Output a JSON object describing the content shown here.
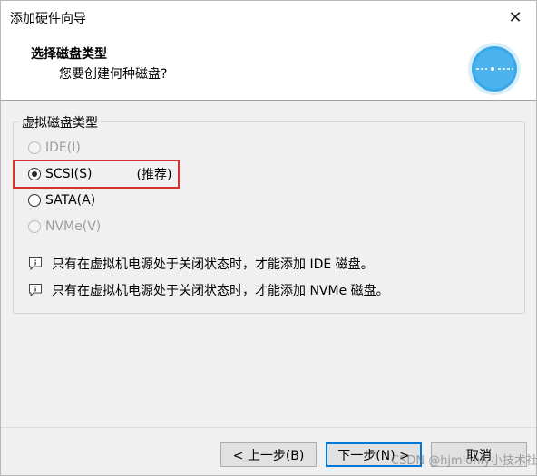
{
  "window": {
    "title": "添加硬件向导",
    "close_glyph": "✕"
  },
  "header": {
    "title": "选择磁盘类型",
    "subtitle": "您要创建何种磁盘?"
  },
  "group": {
    "label": "虚拟磁盘类型",
    "options": [
      {
        "label": "IDE(I)",
        "enabled": false,
        "selected": false
      },
      {
        "label": "SCSI(S)",
        "enabled": true,
        "selected": true,
        "note": "(推荐)"
      },
      {
        "label": "SATA(A)",
        "enabled": true,
        "selected": false
      },
      {
        "label": "NVMe(V)",
        "enabled": false,
        "selected": false
      }
    ],
    "infos": [
      "只有在虚拟机电源处于关闭状态时，才能添加 IDE 磁盘。",
      "只有在虚拟机电源处于关闭状态时，才能添加 NVMe 磁盘。"
    ]
  },
  "buttons": {
    "back": "< 上一步(B)",
    "next": "下一步(N) >",
    "cancel": "取消"
  },
  "watermark": "CSDN @hjmlonly小技术社区",
  "colors": {
    "accent": "#0078d7",
    "highlight": "#d93030",
    "disk_icon": "#39a8ea"
  }
}
